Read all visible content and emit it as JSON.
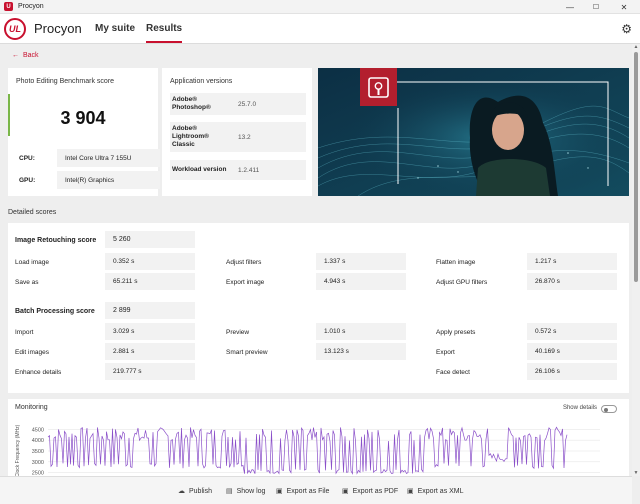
{
  "window": {
    "title": "Procyon",
    "app_icon": "U",
    "controls": [
      "—",
      "☐",
      "✕"
    ]
  },
  "header": {
    "brand": "Procyon",
    "logo": "UL",
    "nav": [
      {
        "label": "My suite",
        "active": false
      },
      {
        "label": "Results",
        "active": true
      }
    ]
  },
  "back": {
    "label": "Back"
  },
  "score": {
    "title": "Photo Editing Benchmark score",
    "value": "3 904",
    "specs": [
      {
        "label": "CPU:",
        "value": "Intel Core Ultra 7 155U"
      },
      {
        "label": "GPU:",
        "value": "Intel(R) Graphics"
      }
    ]
  },
  "versions": {
    "title": "Application versions",
    "items": [
      {
        "name": "Adobe® Photoshop®",
        "value": "25.7.0"
      },
      {
        "name": "Adobe® Lightroom® Classic",
        "value": "13.2"
      },
      {
        "name": "Workload version",
        "value": "1.2.411"
      }
    ]
  },
  "detailed": {
    "title": "Detailed scores",
    "groups": [
      {
        "title": "Image Retouching score",
        "value": "5 260",
        "rows": [
          [
            {
              "label": "Load image",
              "value": "0.352 s"
            },
            {
              "label": "Adjust filters",
              "value": "1.337 s"
            },
            {
              "label": "Flatten image",
              "value": "1.217 s"
            }
          ],
          [
            {
              "label": "Save as",
              "value": "65.211 s"
            },
            {
              "label": "Export image",
              "value": "4.943 s"
            },
            {
              "label": "Adjust GPU filters",
              "value": "26.870 s"
            }
          ]
        ]
      },
      {
        "title": "Batch Processing score",
        "value": "2 899",
        "rows": [
          [
            {
              "label": "Import",
              "value": "3.029 s"
            },
            {
              "label": "Preview",
              "value": "1.010 s"
            },
            {
              "label": "Apply presets",
              "value": "0.572 s"
            }
          ],
          [
            {
              "label": "Edit images",
              "value": "2.881 s"
            },
            {
              "label": "Smart preview",
              "value": "13.123 s"
            },
            {
              "label": "Export",
              "value": "40.169 s"
            }
          ],
          [
            {
              "label": "Enhance details",
              "value": "219.777 s"
            },
            {
              "label": "Face detect",
              "value": "26.106 s"
            }
          ]
        ]
      }
    ]
  },
  "monitoring": {
    "title": "Monitoring",
    "show_details_label": "Show details",
    "show_details_on": false,
    "chart_data": {
      "type": "line",
      "ylabel": "Clock Frequency (MHz)",
      "yticks": [
        4500,
        4000,
        3500,
        3000,
        2500
      ],
      "ylim": [
        2300,
        4700
      ],
      "series_color": "#8a4fc9"
    }
  },
  "footer": {
    "buttons": [
      {
        "label": "Publish",
        "icon": "cloud-upload-icon"
      },
      {
        "label": "Show log",
        "icon": "document-icon"
      },
      {
        "label": "Export as File",
        "icon": "save-icon"
      },
      {
        "label": "Export as PDF",
        "icon": "save-icon"
      },
      {
        "label": "Export as XML",
        "icon": "save-icon"
      }
    ]
  },
  "colors": {
    "accent": "#c8102e",
    "score_bar": "#7ab648",
    "chart_line": "#8a4fc9"
  }
}
